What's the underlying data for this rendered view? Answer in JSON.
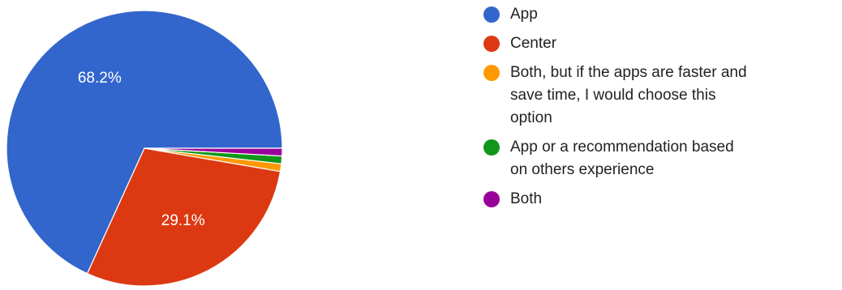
{
  "chart_data": {
    "type": "pie",
    "title": "",
    "start_angle_deg": 0,
    "direction": "counterclockwise",
    "legend_position": "right",
    "slices": [
      {
        "label": "App",
        "value": 68.2,
        "value_label": "68.2%",
        "color": "#3366cc"
      },
      {
        "label": "Center",
        "value": 29.1,
        "value_label": "29.1%",
        "color": "#dc3912"
      },
      {
        "label": "Both, but if the apps are faster and save time, I would choose this option",
        "value": 0.9,
        "value_label": "",
        "color": "#ff9900"
      },
      {
        "label": "App or a recommendation based on others experience",
        "value": 0.9,
        "value_label": "",
        "color": "#109618"
      },
      {
        "label": "Both",
        "value": 0.9,
        "value_label": "",
        "color": "#990099"
      }
    ]
  }
}
